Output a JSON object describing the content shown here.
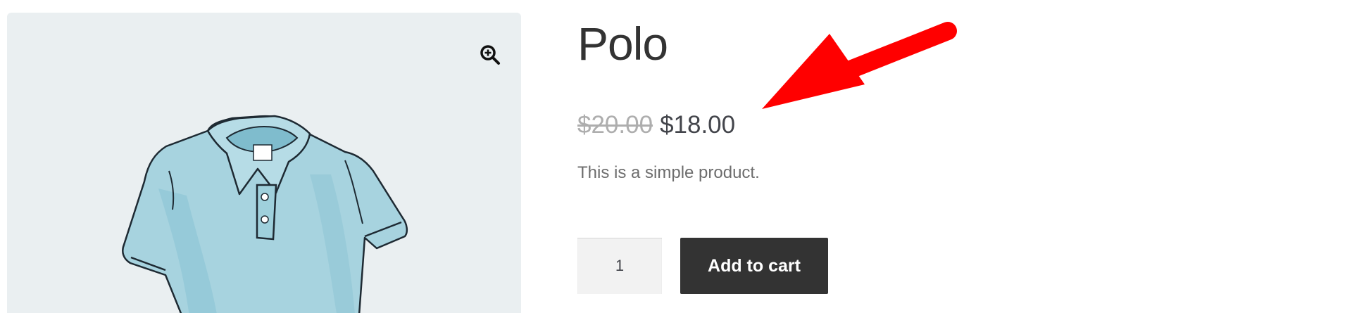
{
  "product": {
    "title": "Polo",
    "regular_price": "$20.00",
    "sale_price": "$18.00",
    "description": "This is a simple product.",
    "image_icon": "polo-shirt-image"
  },
  "cart_form": {
    "quantity_value": "1",
    "add_to_cart_label": "Add to cart"
  },
  "gallery": {
    "zoom_icon": "zoom-in-icon"
  },
  "annotation": {
    "arrow_icon": "red-arrow-icon",
    "arrow_color": "#ff0000"
  },
  "colors": {
    "gallery_bg": "#eaeff1",
    "button_bg": "#333333",
    "price_strike": "#aeaeae",
    "shirt": "#9fd0dc"
  }
}
